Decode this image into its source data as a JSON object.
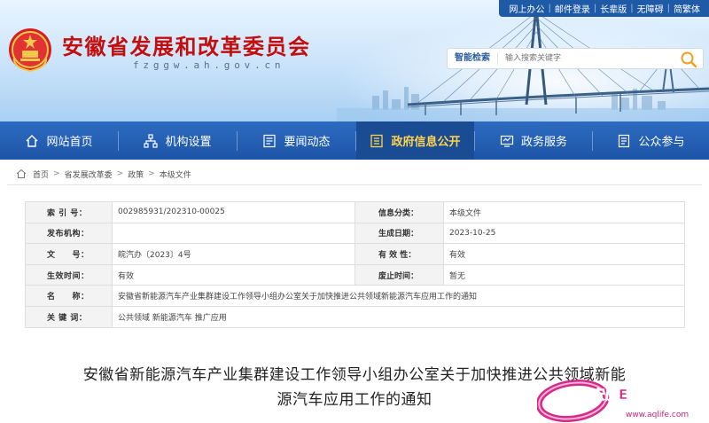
{
  "header": {
    "site_title": "安徽省发展和改革委员会",
    "site_domain": "fzggw.ah.gov.cn",
    "top_links": [
      "网上办公",
      "邮件登录",
      "长辈版",
      "无障碍",
      "简繁体"
    ],
    "search": {
      "label": "智能检索",
      "placeholder": "输入搜索关键字"
    }
  },
  "nav": {
    "items": [
      {
        "label": "网站首页",
        "icon": "home-icon"
      },
      {
        "label": "机构设置",
        "icon": "org-icon"
      },
      {
        "label": "要闻动态",
        "icon": "news-icon"
      },
      {
        "label": "政府信息公开",
        "icon": "info-icon",
        "active": true
      },
      {
        "label": "政务服务",
        "icon": "service-icon"
      },
      {
        "label": "公众参与",
        "icon": "participate-icon"
      }
    ]
  },
  "breadcrumb": [
    "首页",
    "省发展改革委",
    "政策",
    "本级文件"
  ],
  "info": {
    "index_no_label": "索 引 号：",
    "index_no": "002985931/202310-00025",
    "category_label": "信息分类：",
    "category": "本级文件",
    "publisher_label": "发布机构：",
    "publisher": "",
    "created_label": "生成日期：",
    "created": "2023-10-25",
    "doc_no_label": "文　　号：",
    "doc_no": "皖汽办〔2023〕4号",
    "validity_label": "有 效 性：",
    "validity": "有效",
    "effective_label": "生效时间：",
    "effective": "有效",
    "repeal_label": "废止时间：",
    "repeal": "暂无",
    "name_label": "名　　称：",
    "name": "安徽省新能源汽车产业集群建设工作领导小组办公室关于加快推进公共领域新能源汽车应用工作的通知",
    "keywords_label": "关 键 词：",
    "keywords": "公共领域 新能源汽车 推广应用"
  },
  "document": {
    "title_line1": "安徽省新能源汽车产业集群建设工作领导小组办公室关于加快推进公共领域新能",
    "title_line2": "源汽车应用工作的通知"
  },
  "watermark": {
    "text": "安庆E网生活",
    "url": "www.aqlife.com"
  },
  "colors": {
    "brand_red": "#c40d0d",
    "nav_blue": "#1d55a7",
    "nav_active_text": "#ffd34d"
  }
}
